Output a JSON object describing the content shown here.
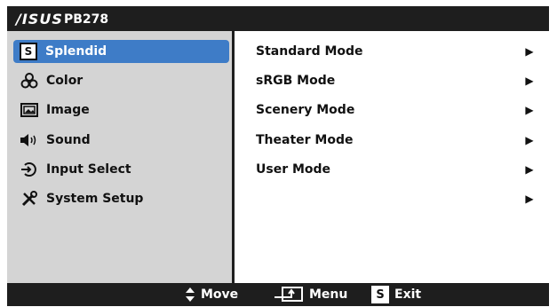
{
  "header": {
    "brand": "/ISUS",
    "model": "PB278"
  },
  "menu": {
    "items": [
      {
        "label": "Splendid",
        "icon": "splendid-s-icon",
        "selected": true
      },
      {
        "label": "Color",
        "icon": "color-icon"
      },
      {
        "label": "Image",
        "icon": "image-icon"
      },
      {
        "label": "Sound",
        "icon": "speaker-icon"
      },
      {
        "label": "Input Select",
        "icon": "input-select-icon"
      },
      {
        "label": "System Setup",
        "icon": "wrench-screwdriver-icon"
      }
    ]
  },
  "submenu": {
    "items": [
      {
        "label": "Standard Mode"
      },
      {
        "label": "sRGB Mode"
      },
      {
        "label": "Scenery Mode"
      },
      {
        "label": "Theater Mode"
      },
      {
        "label": "User Mode"
      },
      {
        "label": ""
      }
    ]
  },
  "footer": {
    "move": "Move",
    "menu": "Menu",
    "exit": "Exit",
    "exit_badge": "S"
  },
  "icons": {
    "splendid_badge": "S"
  },
  "colors": {
    "bar": "#1e1e1e",
    "left_panel": "#d4d4d4",
    "selected": "#3e7cc7"
  }
}
